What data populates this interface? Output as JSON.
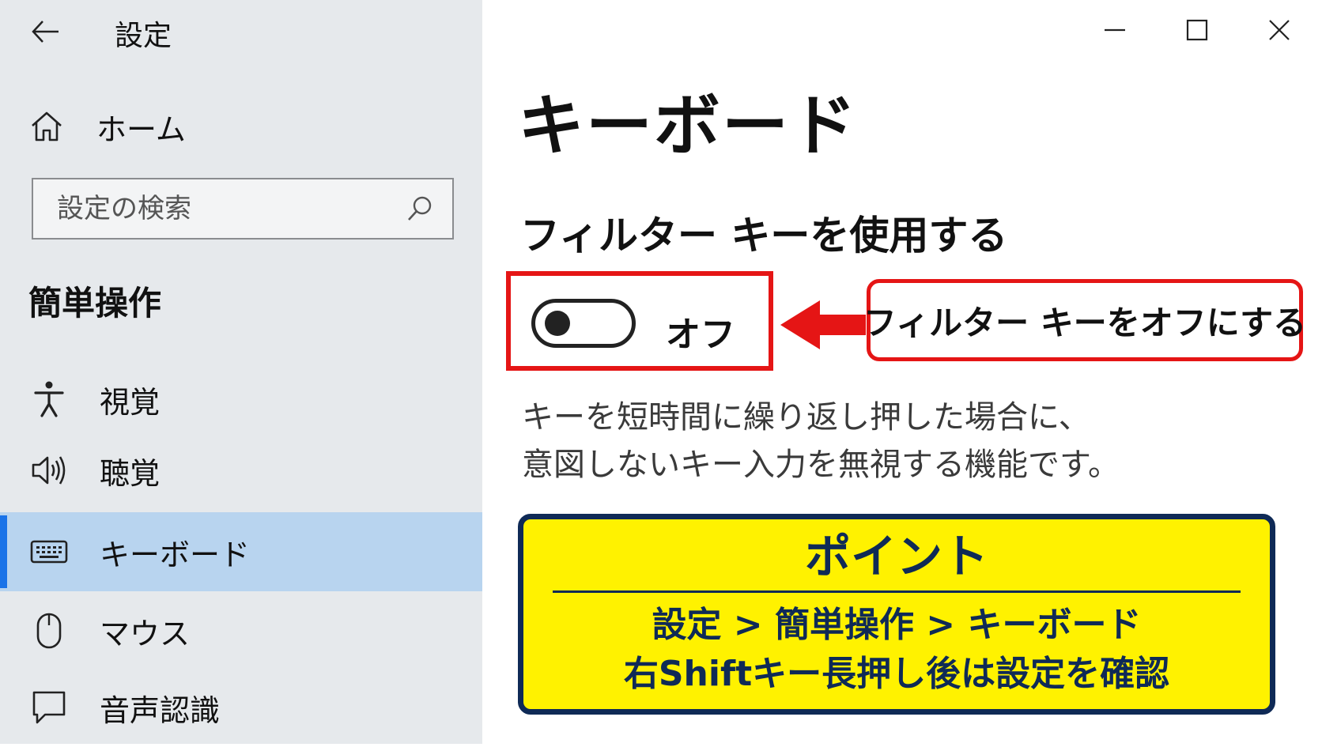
{
  "app": {
    "title": "設定"
  },
  "sidebar": {
    "home_label": "ホーム",
    "search_placeholder": "設定の検索",
    "section_title": "簡単操作",
    "items": [
      {
        "label": "視覚",
        "icon": "accessibility-person-icon"
      },
      {
        "label": "聴覚",
        "icon": "speaker-icon"
      },
      {
        "label": "キーボード",
        "icon": "keyboard-icon",
        "active": true
      },
      {
        "label": "マウス",
        "icon": "mouse-icon"
      },
      {
        "label": "音声認識",
        "icon": "speech-bubble-icon"
      }
    ]
  },
  "main": {
    "page_title": "キーボード",
    "setting_title": "フィルター キーを使用する",
    "toggle_state": "オフ",
    "callout": "フィルター キーをオフにする",
    "description_lines": [
      "キーを短時間に繰り返し押した場合に、",
      "意図しないキー入力を無視する機能です。"
    ],
    "point": {
      "title": "ポイント",
      "line1": "設定 > 簡単操作 > キーボード",
      "line2": "右Shiftキー長押し後は設定を確認"
    }
  },
  "colors": {
    "sidebar_bg": "#e6e9ec",
    "active_item_bg": "#b8d4ef",
    "accent": "#1a73e8",
    "highlight_red": "#e51515",
    "point_bg": "#fff200",
    "point_border": "#0f2a56"
  }
}
